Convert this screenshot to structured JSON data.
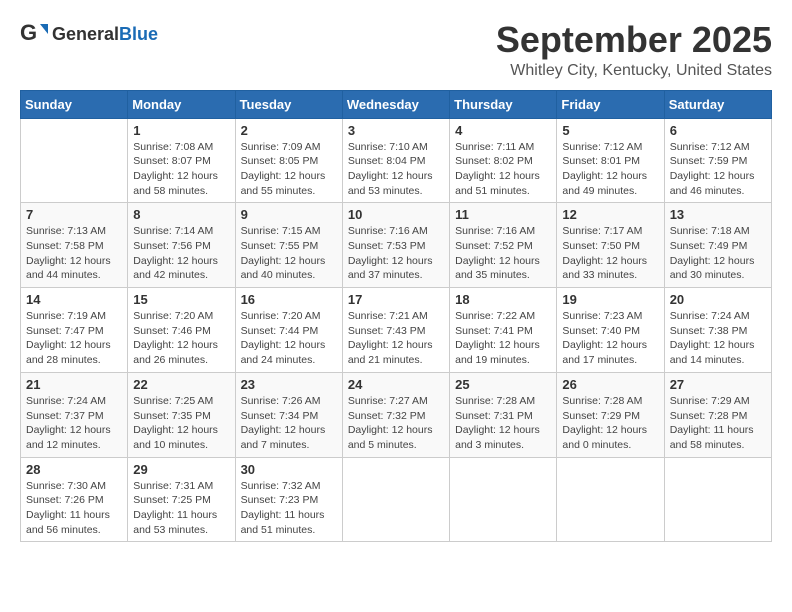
{
  "logo": {
    "general": "General",
    "blue": "Blue"
  },
  "title": "September 2025",
  "location": "Whitley City, Kentucky, United States",
  "days_of_week": [
    "Sunday",
    "Monday",
    "Tuesday",
    "Wednesday",
    "Thursday",
    "Friday",
    "Saturday"
  ],
  "weeks": [
    [
      {
        "day": "",
        "info": ""
      },
      {
        "day": "1",
        "info": "Sunrise: 7:08 AM\nSunset: 8:07 PM\nDaylight: 12 hours\nand 58 minutes."
      },
      {
        "day": "2",
        "info": "Sunrise: 7:09 AM\nSunset: 8:05 PM\nDaylight: 12 hours\nand 55 minutes."
      },
      {
        "day": "3",
        "info": "Sunrise: 7:10 AM\nSunset: 8:04 PM\nDaylight: 12 hours\nand 53 minutes."
      },
      {
        "day": "4",
        "info": "Sunrise: 7:11 AM\nSunset: 8:02 PM\nDaylight: 12 hours\nand 51 minutes."
      },
      {
        "day": "5",
        "info": "Sunrise: 7:12 AM\nSunset: 8:01 PM\nDaylight: 12 hours\nand 49 minutes."
      },
      {
        "day": "6",
        "info": "Sunrise: 7:12 AM\nSunset: 7:59 PM\nDaylight: 12 hours\nand 46 minutes."
      }
    ],
    [
      {
        "day": "7",
        "info": "Sunrise: 7:13 AM\nSunset: 7:58 PM\nDaylight: 12 hours\nand 44 minutes."
      },
      {
        "day": "8",
        "info": "Sunrise: 7:14 AM\nSunset: 7:56 PM\nDaylight: 12 hours\nand 42 minutes."
      },
      {
        "day": "9",
        "info": "Sunrise: 7:15 AM\nSunset: 7:55 PM\nDaylight: 12 hours\nand 40 minutes."
      },
      {
        "day": "10",
        "info": "Sunrise: 7:16 AM\nSunset: 7:53 PM\nDaylight: 12 hours\nand 37 minutes."
      },
      {
        "day": "11",
        "info": "Sunrise: 7:16 AM\nSunset: 7:52 PM\nDaylight: 12 hours\nand 35 minutes."
      },
      {
        "day": "12",
        "info": "Sunrise: 7:17 AM\nSunset: 7:50 PM\nDaylight: 12 hours\nand 33 minutes."
      },
      {
        "day": "13",
        "info": "Sunrise: 7:18 AM\nSunset: 7:49 PM\nDaylight: 12 hours\nand 30 minutes."
      }
    ],
    [
      {
        "day": "14",
        "info": "Sunrise: 7:19 AM\nSunset: 7:47 PM\nDaylight: 12 hours\nand 28 minutes."
      },
      {
        "day": "15",
        "info": "Sunrise: 7:20 AM\nSunset: 7:46 PM\nDaylight: 12 hours\nand 26 minutes."
      },
      {
        "day": "16",
        "info": "Sunrise: 7:20 AM\nSunset: 7:44 PM\nDaylight: 12 hours\nand 24 minutes."
      },
      {
        "day": "17",
        "info": "Sunrise: 7:21 AM\nSunset: 7:43 PM\nDaylight: 12 hours\nand 21 minutes."
      },
      {
        "day": "18",
        "info": "Sunrise: 7:22 AM\nSunset: 7:41 PM\nDaylight: 12 hours\nand 19 minutes."
      },
      {
        "day": "19",
        "info": "Sunrise: 7:23 AM\nSunset: 7:40 PM\nDaylight: 12 hours\nand 17 minutes."
      },
      {
        "day": "20",
        "info": "Sunrise: 7:24 AM\nSunset: 7:38 PM\nDaylight: 12 hours\nand 14 minutes."
      }
    ],
    [
      {
        "day": "21",
        "info": "Sunrise: 7:24 AM\nSunset: 7:37 PM\nDaylight: 12 hours\nand 12 minutes."
      },
      {
        "day": "22",
        "info": "Sunrise: 7:25 AM\nSunset: 7:35 PM\nDaylight: 12 hours\nand 10 minutes."
      },
      {
        "day": "23",
        "info": "Sunrise: 7:26 AM\nSunset: 7:34 PM\nDaylight: 12 hours\nand 7 minutes."
      },
      {
        "day": "24",
        "info": "Sunrise: 7:27 AM\nSunset: 7:32 PM\nDaylight: 12 hours\nand 5 minutes."
      },
      {
        "day": "25",
        "info": "Sunrise: 7:28 AM\nSunset: 7:31 PM\nDaylight: 12 hours\nand 3 minutes."
      },
      {
        "day": "26",
        "info": "Sunrise: 7:28 AM\nSunset: 7:29 PM\nDaylight: 12 hours\nand 0 minutes."
      },
      {
        "day": "27",
        "info": "Sunrise: 7:29 AM\nSunset: 7:28 PM\nDaylight: 11 hours\nand 58 minutes."
      }
    ],
    [
      {
        "day": "28",
        "info": "Sunrise: 7:30 AM\nSunset: 7:26 PM\nDaylight: 11 hours\nand 56 minutes."
      },
      {
        "day": "29",
        "info": "Sunrise: 7:31 AM\nSunset: 7:25 PM\nDaylight: 11 hours\nand 53 minutes."
      },
      {
        "day": "30",
        "info": "Sunrise: 7:32 AM\nSunset: 7:23 PM\nDaylight: 11 hours\nand 51 minutes."
      },
      {
        "day": "",
        "info": ""
      },
      {
        "day": "",
        "info": ""
      },
      {
        "day": "",
        "info": ""
      },
      {
        "day": "",
        "info": ""
      }
    ]
  ]
}
